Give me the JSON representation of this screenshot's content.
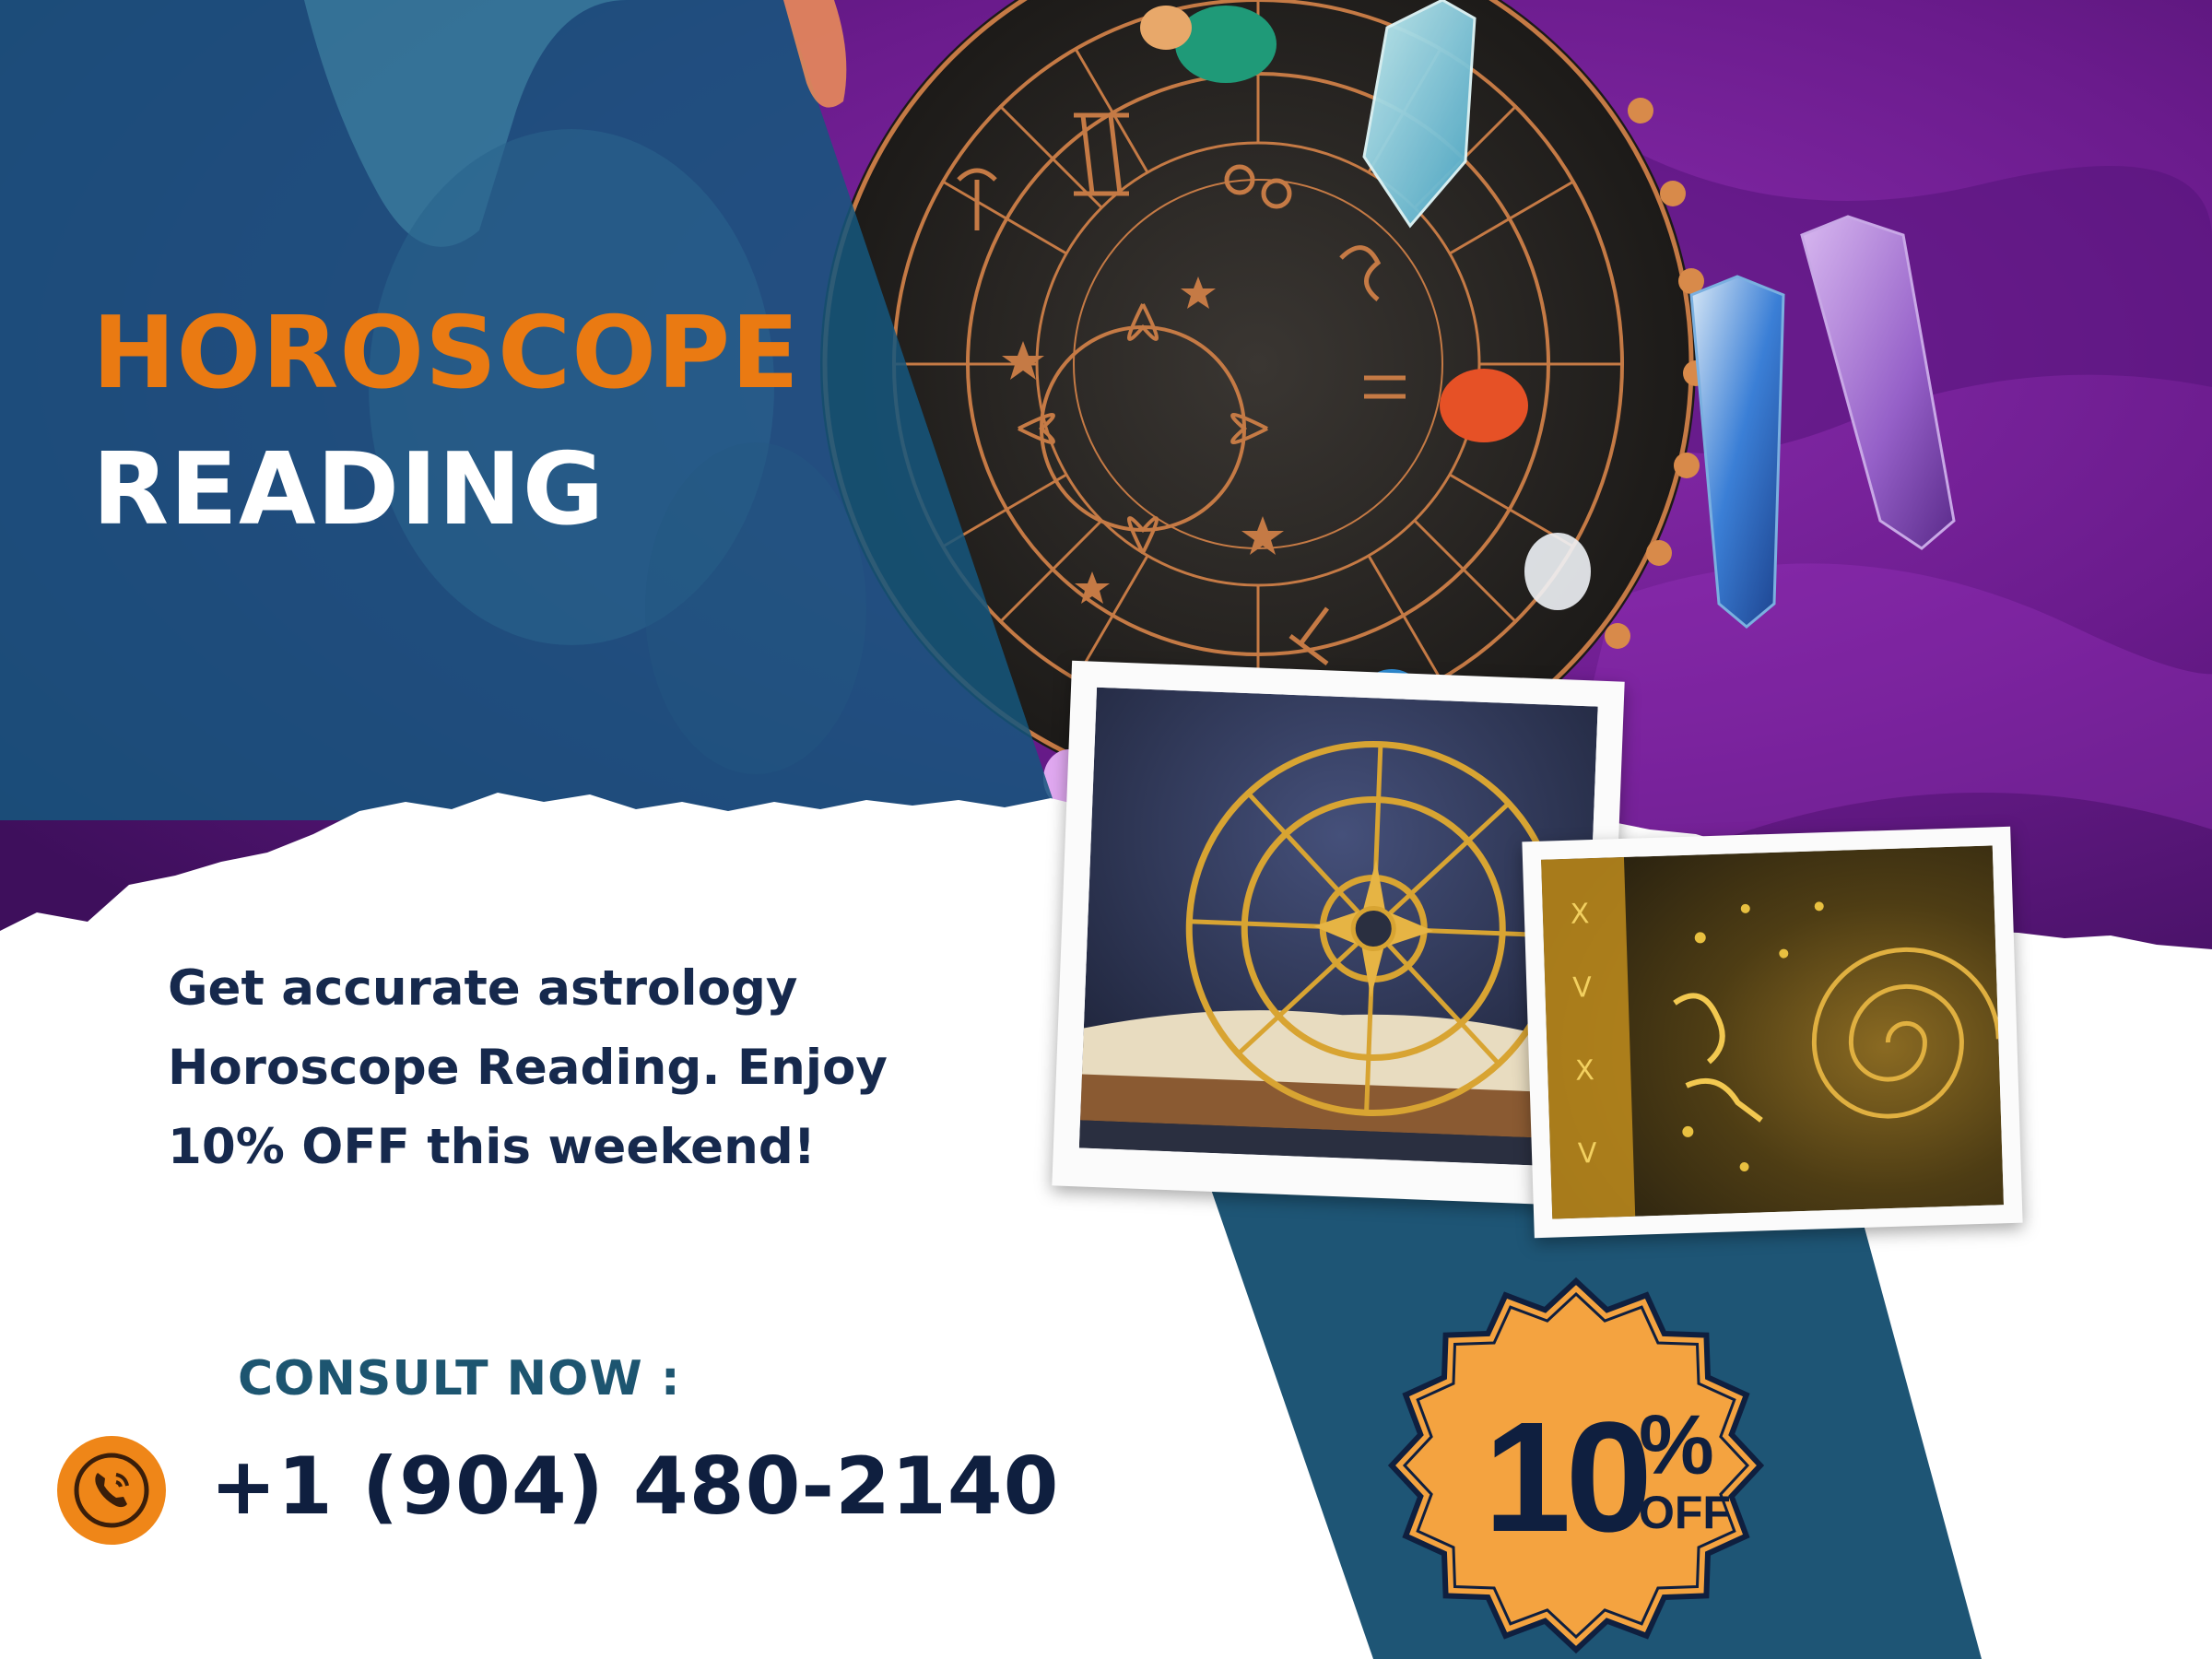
{
  "headline": {
    "line1": "HOROSCOPE",
    "line2": "READING"
  },
  "tagline": {
    "line1": "Get accurate astrology",
    "line2": "Horoscope Reading. Enjoy",
    "line3": "10% OFF this weekend!"
  },
  "contact": {
    "consult_label": "CONSULT NOW :",
    "phone_number": "+1 (904) 480-2140",
    "phone_icon": "phone-call-icon"
  },
  "badge": {
    "percent": "10",
    "percent_symbol": "%",
    "off_label": "OFF"
  },
  "colors": {
    "accent_orange": "#ea7a12",
    "navy": "#0f1f3f",
    "teal_blue": "#1e5575",
    "purple_velvet": "#6a1b8c",
    "badge_orange": "#f4a340"
  }
}
